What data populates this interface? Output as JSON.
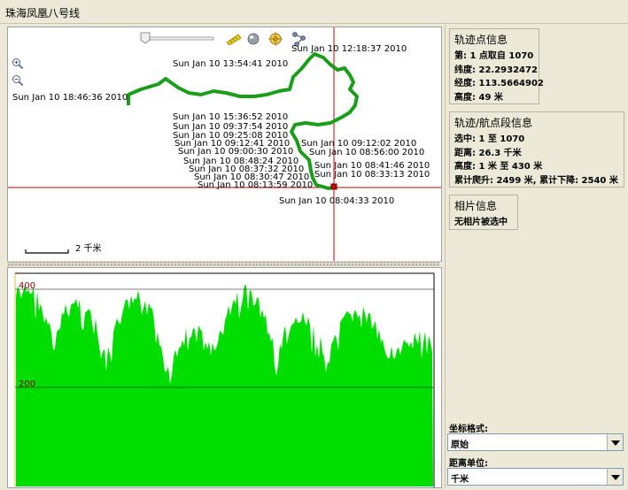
{
  "window": {
    "title": "珠海凤凰八号线"
  },
  "map": {
    "scale_label": "2 千米",
    "track_labels": [
      "Sun Jan 10 12:18:37 2010",
      "Sun Jan 10 13:54:41 2010",
      "Sun Jan 10 18:46:36 2010",
      "Sun Jan 10 15:36:52 2010",
      "Sun Jan 10 09:37:54 2010",
      "Sun Jan 10 09:25:08 2010",
      "Sun Jan 10 09:12:41 2010",
      "Sun Jan 10 09:12:02 2010",
      "Sun Jan 10 09:00:30 2010",
      "Sun Jan 10 08:56:00 2010",
      "Sun Jan 10 08:48:24 2010",
      "Sun Jan 10 08:41:46 2010",
      "Sun Jan 10 08:37:32 2010",
      "Sun Jan 10 08:33:13 2010",
      "Sun Jan 10 08:30:47 2010",
      "Sun Jan 10 08:13:59 2010",
      "Sun Jan 10 08:04:33 2010"
    ],
    "zoom_slider": 0.05,
    "colors": {
      "track": "#1a9e1a",
      "crosshair": "#c00000"
    }
  },
  "elevation": {
    "y_labels": [
      "400",
      "200"
    ],
    "fill_color": "#00dd00"
  },
  "trackpoint": {
    "title": "轨迹点信息",
    "lines": [
      "第: 1 点取自 1070",
      "纬度: 22.2932472",
      "经度: 113.5664902",
      "高度: 49 米"
    ]
  },
  "segment": {
    "title": "轨迹/航点段信息",
    "lines": [
      "选中: 1 至 1070",
      "距离: 26.3 千米",
      "高度: 1 米 至 430 米",
      "累计爬升: 2499 米, 累计下降: 2540 米"
    ]
  },
  "photo": {
    "title": "相片信息",
    "lines": [
      "无相片被选中"
    ]
  },
  "coord_format": {
    "label": "坐标格式:",
    "value": "原始"
  },
  "distance_units": {
    "label": "距离单位:",
    "value": "千米"
  }
}
